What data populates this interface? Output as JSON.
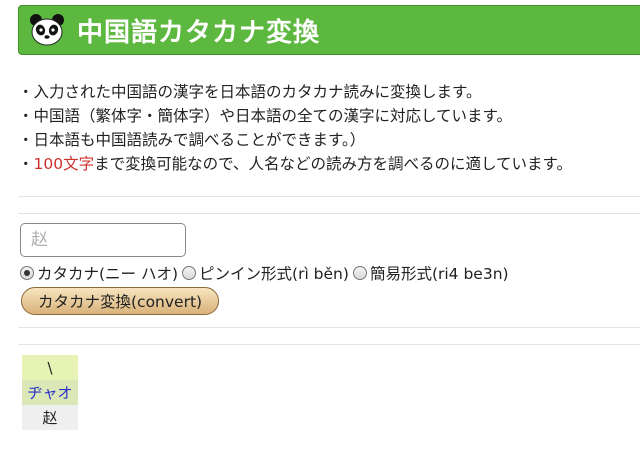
{
  "header": {
    "title": "中国語カタカナ変換",
    "icon": "panda-icon"
  },
  "description": {
    "line1": "・入力された中国語の漢字を日本語のカタカナ読みに変換します。",
    "line2": "・中国語（繁体字・簡体字）や日本語の全ての漢字に対応しています。",
    "line3": "・日本語も中国語読みで調べることができます。）",
    "line4_prefix": "・",
    "line4_highlight": "100文字",
    "line4_rest": "まで変換可能なので、人名などの読み方を調べるのに適しています。"
  },
  "form": {
    "input_placeholder": "赵",
    "radio_options": [
      {
        "label": "カタカナ(ニー ハオ)",
        "checked": true
      },
      {
        "label": "ピンイン形式(rì běn)",
        "checked": false
      },
      {
        "label": "簡易形式(ri4 be3n)",
        "checked": false
      }
    ],
    "convert_label": "カタカナ変換(convert)"
  },
  "result": {
    "tone": "\\",
    "katakana": "ヂャオ",
    "hanzi": "赵"
  },
  "colors": {
    "header_green": "#5cb83f",
    "highlight_red": "#d0312d",
    "katakana_blue": "#2530c8"
  }
}
